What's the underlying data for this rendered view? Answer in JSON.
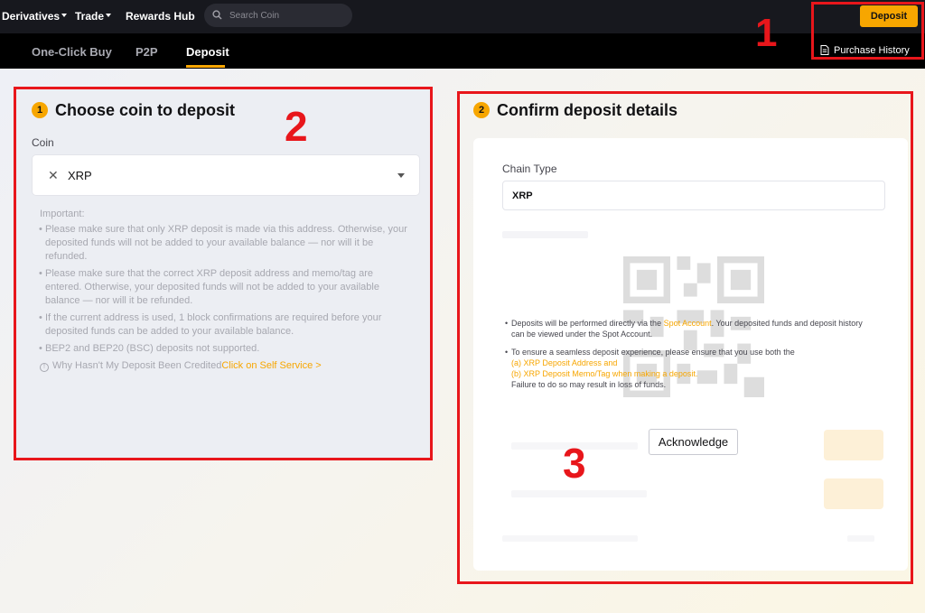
{
  "topbar": {
    "nav": [
      {
        "label": "Derivatives",
        "has_caret": true
      },
      {
        "label": "Trade",
        "has_caret": true
      },
      {
        "label": "Rewards Hub",
        "has_caret": false
      }
    ],
    "search": {
      "placeholder": "Search Coin",
      "value": "",
      "icon": "search-icon"
    },
    "deposit_button": "Deposit"
  },
  "subnav": {
    "tabs": [
      {
        "label": "One-Click Buy",
        "active": false
      },
      {
        "label": "P2P",
        "active": false
      },
      {
        "label": "Deposit",
        "active": true
      }
    ],
    "purchase_history": {
      "label": "Purchase History",
      "icon": "document-icon"
    }
  },
  "step1": {
    "number": "1",
    "title": "Choose coin to deposit",
    "coin_label": "Coin",
    "coin_clear_icon": "close-icon",
    "coin_value": "XRP",
    "important": {
      "heading": "Important:",
      "items": [
        "Please make sure that only XRP deposit is made via this address. Otherwise, your deposited funds will not be added to your available balance — nor will it be refunded.",
        "Please make sure that the correct XRP deposit address and memo/tag are entered. Otherwise, your deposited funds will not be added to your available balance — nor will it be refunded.",
        "If the current address is used, 1 block confirmations are required before your deposited funds can be added to your available balance.",
        "BEP2 and BEP20 (BSC) deposits not supported."
      ],
      "why_text": "Why Hasn't My Deposit Been Credited",
      "self_service_link": "Click on Self Service >"
    }
  },
  "step2": {
    "number": "2",
    "title": "Confirm deposit details",
    "chain_label": "Chain Type",
    "chain_value": "XRP",
    "notice": {
      "line1_pre": "Deposits will be performed directly via the ",
      "line1_link": "Spot Account",
      "line1_post": ". Your deposited funds and deposit history can be viewed under the Spot Account.",
      "line2_intro": "To ensure a seamless deposit experience, please ensure that you use both the",
      "line2_a": "(a) XRP Deposit Address and",
      "line2_b": "(b) XRP Deposit Memo/Tag when making a deposit.",
      "line2_end": "Failure to do so may result in loss of funds."
    },
    "acknowledge_button": "Acknowledge"
  },
  "annotations": {
    "numbers": [
      "1",
      "2",
      "3"
    ],
    "color": "#e8161b"
  },
  "colors": {
    "accent": "#f7a600",
    "topbar": "#17181e",
    "subbar": "#000000"
  }
}
